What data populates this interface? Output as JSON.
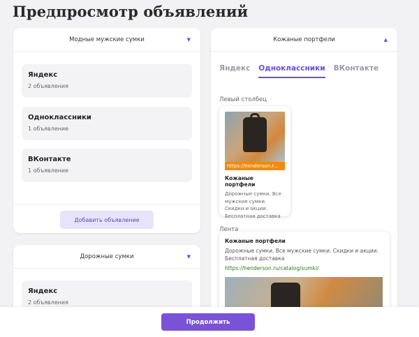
{
  "page": {
    "title": "Предпросмотр объявлений"
  },
  "left_cards": [
    {
      "header": "Модные мужские сумки",
      "networks": [
        {
          "name": "Яндекс",
          "count": "2 объявления"
        },
        {
          "name": "Одноклассники",
          "count": "1 объявление"
        },
        {
          "name": "ВКонтакте",
          "count": "1 объявление"
        }
      ],
      "add_label": "Добавить объявление"
    },
    {
      "header": "Дорожные сумки",
      "networks": [
        {
          "name": "Яндекс",
          "count": "2 объявления"
        }
      ]
    }
  ],
  "right_card": {
    "header": "Кожаные портфели",
    "tabs": [
      "Яндекс",
      "Одноклассники",
      "ВКонтакте"
    ],
    "active_tab": "Одноклассники",
    "left_column_label": "Левый столбец",
    "preview": {
      "url": "https://henderson.r...",
      "title": "Кожаные портфели",
      "text": "Дорожные сумки. Все мужские сумки. Скидки и акции. Бесплатная доставка"
    },
    "feed_label": "Лента",
    "feed": {
      "title": "Кожаные портфели",
      "text": "Дорожные сумки. Все мужские сумки. Скидки и акции. Бесплатная доставка",
      "link": "https://henderson.ru/catalog/sumki/"
    }
  },
  "footer": {
    "continue_label": "Продолжить"
  },
  "colors": {
    "accent": "#7a52d8",
    "link_green": "#2b7a1e",
    "url_orange": "#f08a12"
  },
  "icons": {
    "collapse": "chevron-down-icon",
    "expand": "chevron-up-icon"
  }
}
